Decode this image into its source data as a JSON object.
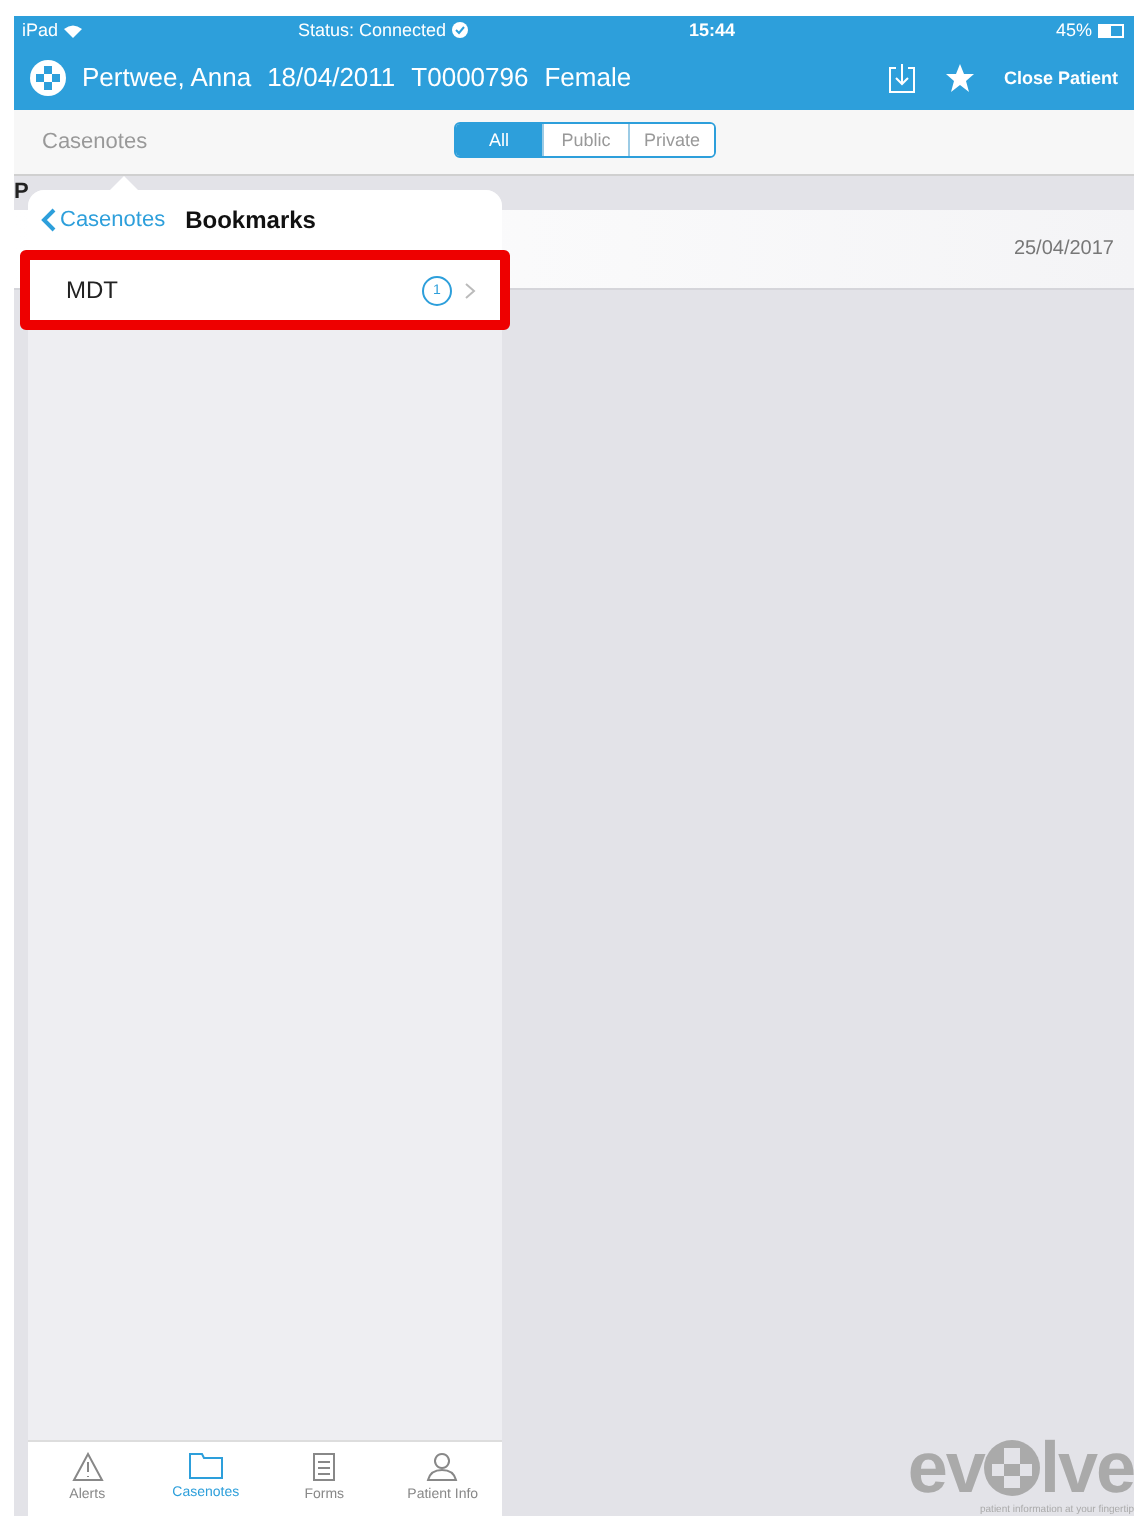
{
  "status_bar": {
    "device": "iPad",
    "status": "Status: Connected",
    "time": "15:44",
    "battery": "45%"
  },
  "patient_header": {
    "name": "Pertwee, Anna",
    "dob": "18/04/2011",
    "id": "T0000796",
    "sex": "Female",
    "close_button": "Close Patient"
  },
  "casenotes_bar": {
    "title": "Casenotes",
    "filters": [
      {
        "label": "All",
        "selected": true
      },
      {
        "label": "Public",
        "selected": false
      },
      {
        "label": "Private",
        "selected": false
      }
    ]
  },
  "section_header": "P",
  "note_row": {
    "date": "25/04/2017"
  },
  "popover": {
    "back": "Casenotes",
    "title": "Bookmarks",
    "items": [
      {
        "label": "MDT",
        "count": "1",
        "highlighted": true
      }
    ],
    "tabs": [
      {
        "label": "Alerts",
        "kind": "alert",
        "selected": false
      },
      {
        "label": "Casenotes",
        "kind": "folder",
        "selected": true
      },
      {
        "label": "Forms",
        "kind": "form",
        "selected": false
      },
      {
        "label": "Patient Info",
        "kind": "person",
        "selected": false
      }
    ]
  },
  "logo": {
    "left": "ev",
    "right": "lve",
    "tagline": "patient information at your fingertip"
  }
}
